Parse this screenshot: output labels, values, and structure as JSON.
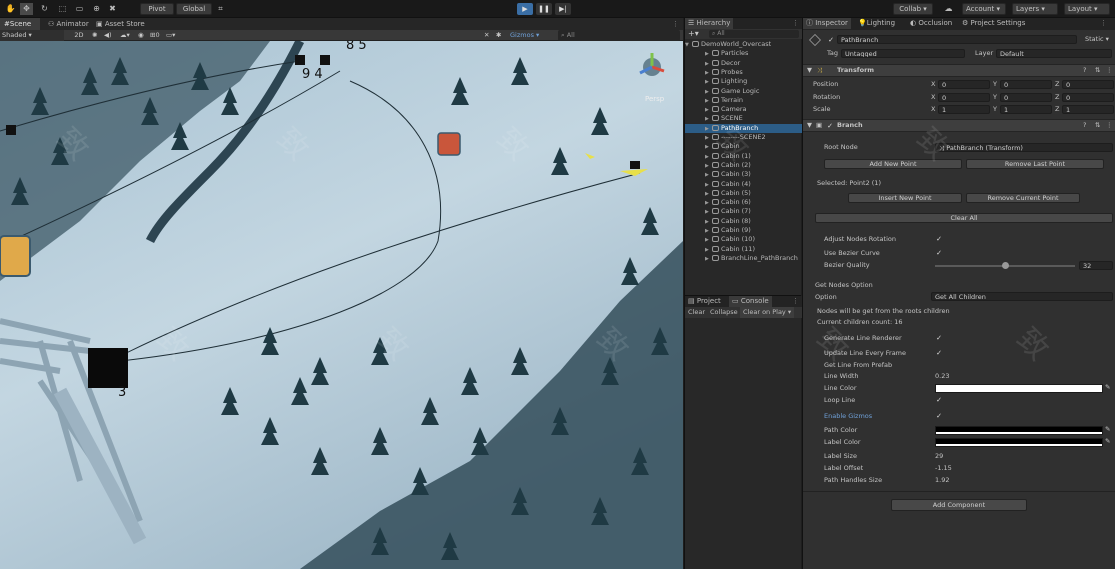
{
  "toolbar": {
    "pivot": "Pivot",
    "global": "Global",
    "collab": "Collab",
    "account": "Account",
    "layers": "Layers",
    "layout": "Layout"
  },
  "scene_tabs": [
    "Scene",
    "Animator",
    "Asset Store"
  ],
  "scene_bar": {
    "shading": "Shaded",
    "mode2d": "2D",
    "gizmos": "Gizmos",
    "search": "All",
    "layer_count": "0"
  },
  "scene_labels": {
    "l85": "8 5",
    "l94": "9 4",
    "l3": "3",
    "persp": "Persp"
  },
  "hierarchy": {
    "tab": "Hierarchy",
    "search_placeholder": "All",
    "scene": "DemoWorld_Overcast",
    "items": [
      "Particles",
      "Decor",
      "Probes",
      "Lighting",
      "Game Logic",
      "Terrain",
      "Camera",
      "SCENE",
      "PathBranch",
      "--------SCENE2",
      "Cabin",
      "Cabin (1)",
      "Cabin (2)",
      "Cabin (3)",
      "Cabin (4)",
      "Cabin (5)",
      "Cabin (6)",
      "Cabin (7)",
      "Cabin (8)",
      "Cabin (9)",
      "Cabin (10)",
      "Cabin (11)",
      "BranchLine_PathBranch"
    ]
  },
  "project": {
    "tab1": "Project",
    "tab2": "Console",
    "clear": "Clear",
    "collapse": "Collapse",
    "clear_on_play": "Clear on Play"
  },
  "inspector": {
    "tabs": [
      "Inspector",
      "Lighting",
      "Occlusion",
      "Project Settings"
    ],
    "object_name": "PathBranch",
    "static": "Static",
    "tag_label": "Tag",
    "tag_value": "Untagged",
    "layer_label": "Layer",
    "layer_value": "Default",
    "transform": {
      "title": "Transform",
      "rows": [
        {
          "label": "Position",
          "x": "0",
          "y": "0",
          "z": "0"
        },
        {
          "label": "Rotation",
          "x": "0",
          "y": "0",
          "z": "0"
        },
        {
          "label": "Scale",
          "x": "1",
          "y": "1",
          "z": "1"
        }
      ]
    },
    "branch": {
      "title": "Branch",
      "root_node_label": "Root Node",
      "root_node_value": "PathBranch (Transform)",
      "add_new_point": "Add New Point",
      "remove_last_point": "Remove Last Point",
      "selected": "Selected: Point2 (1)",
      "insert_new_point": "Insert New Point",
      "remove_current_point": "Remove Current Point",
      "clear_all": "Clear All",
      "adjust_nodes_rotation": "Adjust Nodes Rotation",
      "use_bezier_curve": "Use Bezier Curve",
      "bezier_quality": "Bezier Quality",
      "bezier_quality_value": "32",
      "bezier_quality_fraction": 0.5,
      "get_nodes_option": "Get Nodes Option",
      "option_label": "Option",
      "option_value": "Get All Children",
      "info1": "Nodes will be get from the roots children",
      "info2": "Current children count: 16",
      "generate_line_renderer": "Generate Line Renderer",
      "update_line_every_frame": "Update Line Every Frame",
      "get_line_from_prefab": "Get Line From Prefab",
      "line_width_label": "Line Width",
      "line_width_value": "0.23",
      "line_color": "Line Color",
      "loop_line": "Loop Line",
      "enable_gizmos": "Enable Gizmos",
      "path_color": "Path Color",
      "label_color": "Label Color",
      "label_size_label": "Label Size",
      "label_size_value": "29",
      "label_offset_label": "Label Offset",
      "label_offset_value": "-1.15",
      "path_handles_label": "Path Handles Size",
      "path_handles_value": "1.92",
      "add_component": "Add Component"
    }
  },
  "colors": {
    "accent": "#2c5d87",
    "play": "#3a6ea5",
    "gizmos_link": "#6fa0d8"
  }
}
